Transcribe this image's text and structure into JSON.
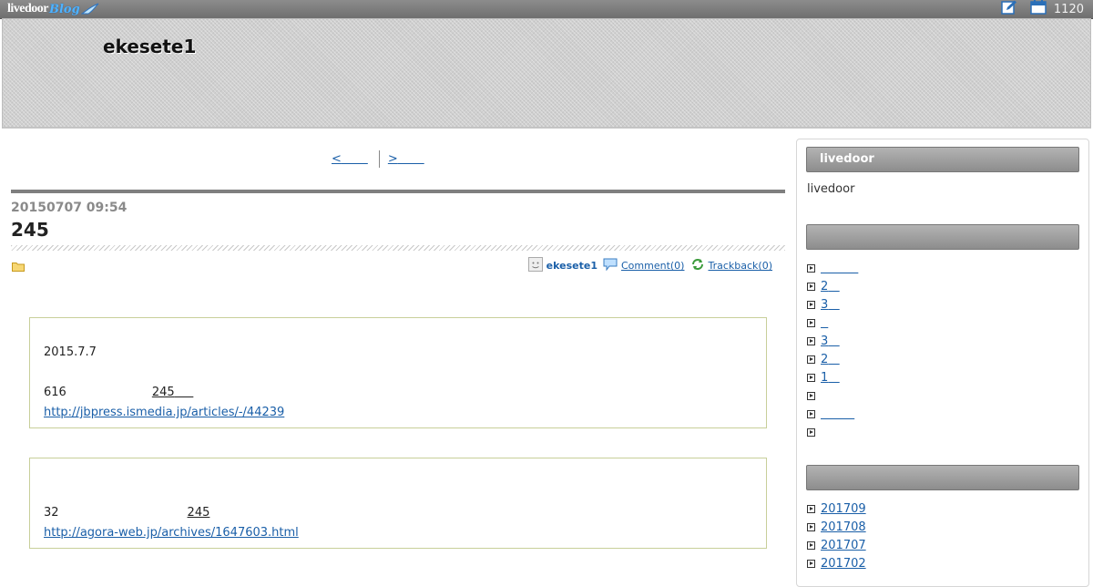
{
  "topbar": {
    "logo_text": "livedoor",
    "logo_blog": "Blog",
    "count": "1120",
    "icons": [
      "edit-icon",
      "calendar-icon"
    ]
  },
  "header": {
    "blog_title": "ekesete1"
  },
  "pager": {
    "prev": "<",
    "next": ">"
  },
  "entry": {
    "date": "20150707 09:54",
    "title": "245",
    "author": "ekesete1",
    "comment": "Comment(0)",
    "trackback": "Trackback(0)"
  },
  "quotes": [
    {
      "date": "2015.7.7",
      "line_a": "616",
      "line_b": "245",
      "url": "http://jbpress.ismedia.jp/articles/-/44239"
    },
    {
      "line_a": "32",
      "line_b": "245",
      "url": "http://agora-web.jp/archives/1647603.html"
    }
  ],
  "sidebar": {
    "profile_head": "livedoor",
    "profile_text": "livedoor",
    "cat_head": "",
    "categories": [
      "",
      "2",
      "3",
      "",
      "3",
      "2",
      "1",
      "",
      "",
      ""
    ],
    "archive_head": "",
    "archives": [
      "201709",
      "201708",
      "201707",
      "201702"
    ]
  },
  "colors": {
    "link": "#1a5fa8",
    "quote_border": "#c8cf9a",
    "header_bar": "#8d8d8d"
  }
}
